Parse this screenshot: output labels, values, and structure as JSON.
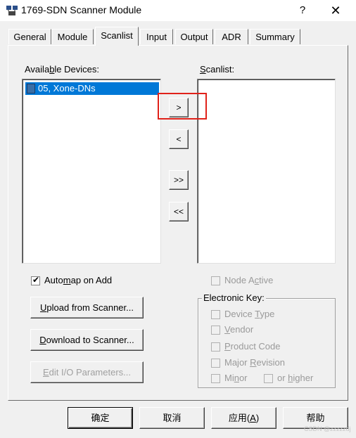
{
  "window": {
    "title": "1769-SDN Scanner Module",
    "help_symbol": "?",
    "close_symbol": "✕"
  },
  "tabs": [
    {
      "label": "General",
      "active": false
    },
    {
      "label": "Module",
      "active": false
    },
    {
      "label": "Scanlist",
      "active": true
    },
    {
      "label": "Input",
      "active": false
    },
    {
      "label": "Output",
      "active": false
    },
    {
      "label": "ADR",
      "active": false
    },
    {
      "label": "Summary",
      "active": false
    }
  ],
  "available_devices": {
    "label_before": "Availa",
    "label_mnemonic": "b",
    "label_after": "le Devices:",
    "items": [
      "05, Xone-DNs"
    ]
  },
  "scanlist": {
    "label_mnemonic": "S",
    "label_after": "canlist:",
    "items": []
  },
  "transfer_buttons": {
    "add": ">",
    "remove": "<",
    "add_all": ">>",
    "remove_all": "<<"
  },
  "options": {
    "automap": {
      "before": "Auto",
      "mnemonic": "m",
      "after": "ap on Add",
      "checked": true
    },
    "upload": {
      "mnemonic": "U",
      "after": "pload from Scanner..."
    },
    "download": {
      "mnemonic": "D",
      "after": "ownload to Scanner..."
    },
    "edit_io": {
      "mnemonic": "E",
      "after": "dit I/O Parameters..."
    }
  },
  "node_active": {
    "before": "Node A",
    "mnemonic": "c",
    "after": "tive"
  },
  "electronic_key": {
    "title": "Electronic Key:",
    "device_type": {
      "before": "Device ",
      "mnemonic": "T",
      "after": "ype"
    },
    "vendor": {
      "mnemonic": "V",
      "after": "endor"
    },
    "product_code": {
      "mnemonic": "P",
      "after": "roduct Code"
    },
    "major_revision": {
      "before": "Major ",
      "mnemonic": "R",
      "after": "evision"
    },
    "minor": {
      "before": "Mi",
      "mnemonic": "n",
      "after": "or"
    },
    "or_higher": {
      "before": "or ",
      "mnemonic": "h",
      "after": "igher"
    }
  },
  "footer": {
    "ok": "确定",
    "cancel": "取消",
    "apply_before": "应用(",
    "apply_mnemonic": "A",
    "apply_after": ")",
    "help": "帮助"
  },
  "watermark": "CSDN @zzzzzdj",
  "colors": {
    "selection": "#0078d7",
    "callout": "#e0221a"
  }
}
